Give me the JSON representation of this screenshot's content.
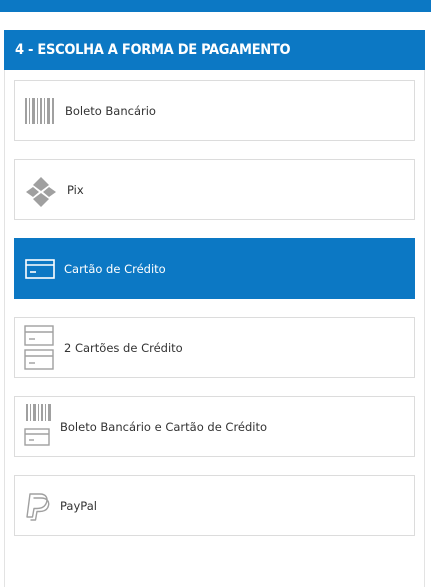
{
  "header": {
    "title": "4 - ESCOLHA A FORMA DE PAGAMENTO"
  },
  "payment_options": [
    {
      "label": "Boleto Bancário",
      "icon": "barcode-icon",
      "selected": false
    },
    {
      "label": "Pix",
      "icon": "pix-icon",
      "selected": false
    },
    {
      "label": "Cartão de Crédito",
      "icon": "credit-card-icon",
      "selected": true
    },
    {
      "label": "2 Cartões de Crédito",
      "icon": "two-credit-cards-icon",
      "selected": false
    },
    {
      "label": "Boleto Bancário e Cartão de Crédito",
      "icon": "barcode-and-card-icon",
      "selected": false
    },
    {
      "label": "PayPal",
      "icon": "paypal-icon",
      "selected": false
    }
  ],
  "colors": {
    "accent": "#0c78c4",
    "icon_gray": "#a0a0a0",
    "border": "#dcdcdc"
  }
}
